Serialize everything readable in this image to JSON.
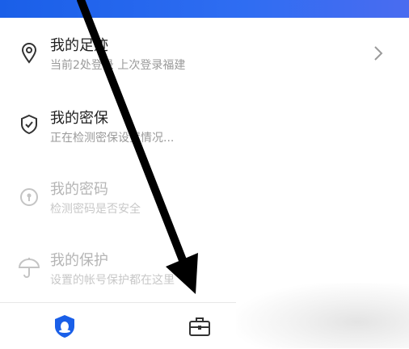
{
  "list": {
    "items": [
      {
        "title": "我的足迹",
        "subtitle": "当前2处登录 上次登录福建",
        "icon": "location-pin-icon"
      },
      {
        "title": "我的密保",
        "subtitle": "正在检测密保设置情况...",
        "icon": "shield-check-icon"
      },
      {
        "title": "我的密码",
        "subtitle": "检测密码是否安全",
        "icon": "password-lock-icon"
      },
      {
        "title": "我的保护",
        "subtitle": "设置的帐号保护都在这里",
        "icon": "umbrella-icon"
      }
    ]
  },
  "tabs": [
    {
      "icon": "qq-security-shield-icon",
      "color": "#1a5fe8"
    },
    {
      "icon": "toolbox-icon",
      "color": "#333333"
    }
  ],
  "colors": {
    "accent": "#1a5fe8",
    "header": "#2f6df2"
  }
}
